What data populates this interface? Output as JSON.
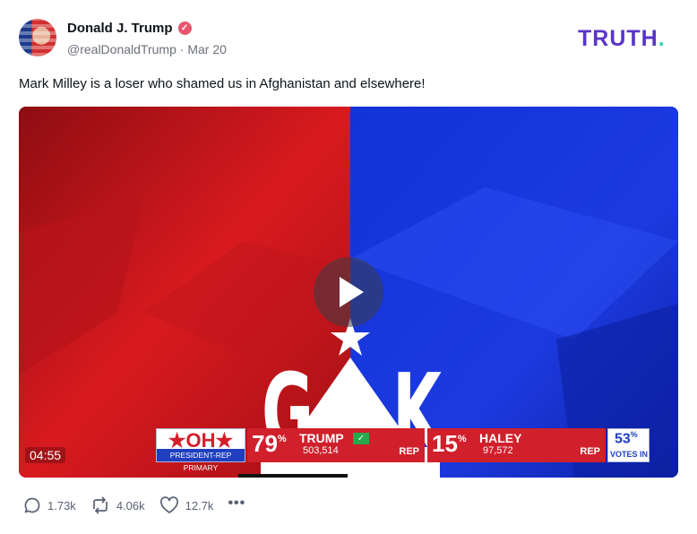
{
  "author": {
    "name": "Donald J. Trump",
    "handle": "@realDonaldTrump",
    "date": "Mar 20",
    "separator": "·"
  },
  "brand": {
    "logo_text": "TRUTH",
    "logo_dot": ".",
    "color": "#5a35c8",
    "accent": "#2fd6b9"
  },
  "post": {
    "text": "Mark Milley is a loser who shamed us in Afghanistan and elsewhere!"
  },
  "video": {
    "duration": "04:55",
    "letters": {
      "left": "G",
      "right": "K"
    },
    "banner": {
      "state": "OH",
      "state_full": "★OH★",
      "race": "PRESIDENT-REP PRIMARY",
      "candidates": [
        {
          "pct": "79",
          "name": "TRUMP",
          "votes": "503,514",
          "party": "REP",
          "winner": true
        },
        {
          "pct": "15",
          "name": "HALEY",
          "votes": "97,572",
          "party": "REP",
          "winner": false
        }
      ],
      "votes_in_pct": "53",
      "votes_in_label": "VOTES IN"
    }
  },
  "stats": {
    "replies": "1.73k",
    "retruths": "4.06k",
    "likes": "12.7k",
    "more": "•••"
  },
  "icons": [
    "verified-icon",
    "reply-icon",
    "retruth-icon",
    "like-icon",
    "more-icon",
    "play-icon"
  ]
}
